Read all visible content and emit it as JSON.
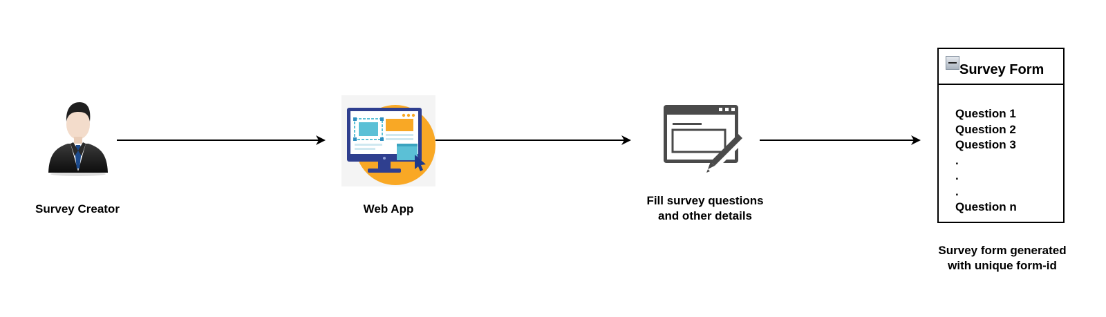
{
  "nodes": {
    "creator": {
      "label": "Survey Creator",
      "icon": "businessman-icon"
    },
    "webapp": {
      "label": "Web App",
      "icon": "monitor-web-app-icon"
    },
    "fill": {
      "label_line1": "Fill survey questions",
      "label_line2": "and other details",
      "icon": "form-edit-icon"
    },
    "form": {
      "title": "Survey Form",
      "icon": "collapse-icon",
      "questions": [
        "Question 1",
        "Question 2",
        "Question 3",
        ".",
        ".",
        ".",
        "Question n"
      ],
      "caption_line1": "Survey form generated",
      "caption_line2": "with unique form-id"
    }
  },
  "colors": {
    "arrow": "#000000",
    "monitor_frame": "#2f3f8f",
    "accent_orange": "#f9a825",
    "accent_teal": "#5bc0d6",
    "form_icon_gray": "#4a4a4a"
  }
}
